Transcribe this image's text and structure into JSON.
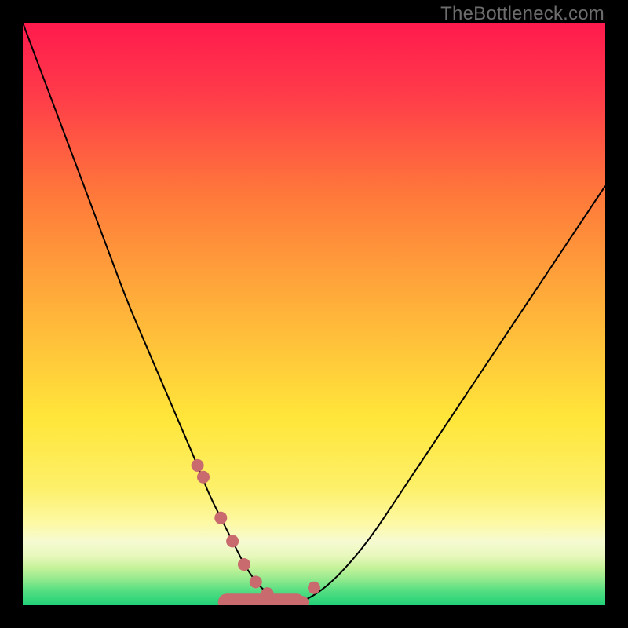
{
  "watermark": "TheBottleneck.com",
  "colors": {
    "top": "#ff1a4d",
    "orange": "#ff8a35",
    "yellow": "#ffe63a",
    "lightyellow": "#fdf9a6",
    "paleband": "#f6fad1",
    "green1": "#c6f29a",
    "green2": "#7de384",
    "green3": "#27d37a",
    "black": "#000000",
    "marker": "#c96a6e"
  },
  "chart_data": {
    "type": "line",
    "title": "",
    "xlabel": "",
    "ylabel": "",
    "xlim": [
      0,
      100
    ],
    "ylim": [
      0,
      100
    ],
    "legend": false,
    "grid": false,
    "series": [
      {
        "name": "curve",
        "x": [
          0,
          3,
          6,
          9,
          12,
          15,
          18,
          21,
          24,
          27,
          30,
          32,
          34,
          36,
          38,
          40,
          42,
          45,
          48,
          52,
          56,
          60,
          64,
          68,
          72,
          76,
          80,
          84,
          88,
          92,
          96,
          100
        ],
        "y": [
          100,
          92,
          84,
          76,
          68,
          60,
          52,
          45,
          38,
          31,
          24,
          19,
          15,
          11,
          7,
          4,
          2,
          0.2,
          0.5,
          3,
          7,
          12,
          18,
          24,
          30,
          36,
          42,
          48,
          54,
          60,
          66,
          72
        ]
      }
    ],
    "markers": {
      "name": "dots",
      "x": [
        30,
        31,
        34,
        36,
        38,
        40,
        42,
        45,
        48,
        50
      ],
      "y": [
        24,
        22,
        15,
        11,
        7,
        4,
        2,
        0.2,
        0.5,
        3
      ]
    },
    "lowband": {
      "xrange": [
        35,
        47
      ],
      "y": 0.5
    }
  }
}
